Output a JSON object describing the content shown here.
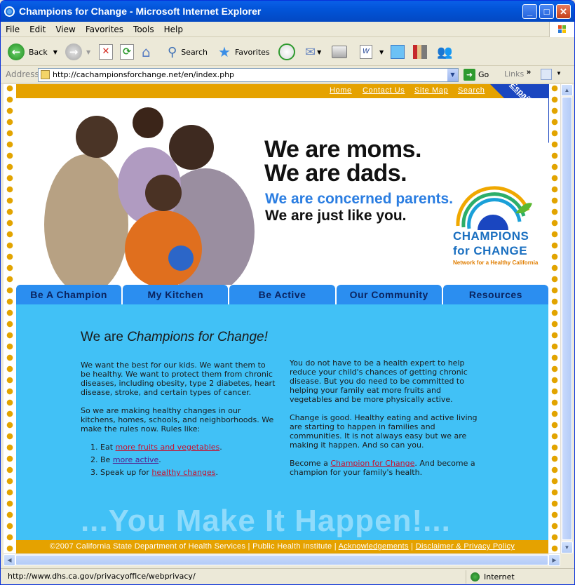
{
  "window": {
    "title": "Champions for Change - Microsoft Internet Explorer"
  },
  "menu": [
    "File",
    "Edit",
    "View",
    "Favorites",
    "Tools",
    "Help"
  ],
  "toolbar": {
    "back": "Back",
    "search": "Search",
    "favorites": "Favorites"
  },
  "address": {
    "label": "Address",
    "url": "http://cachampionsforchange.net/en/index.php",
    "go": "Go",
    "links": "Links"
  },
  "status": {
    "text": "http://www.dhs.ca.gov/privacyoffice/webprivacy/",
    "zone": "Internet"
  },
  "site": {
    "topnav": [
      "Home",
      "Contact Us",
      "Site Map",
      "Search"
    ],
    "espanol": "Español",
    "hero": {
      "line1": "We are moms.",
      "line2": "We are dads.",
      "line3": "We are concerned parents.",
      "line4": "We are just like you."
    },
    "logo": {
      "line1": "CHAMPIONS",
      "line2": "for CHANGE",
      "tagline": "Network for a Healthy California"
    },
    "mainnav": [
      "Be A Champion",
      "My Kitchen",
      "Be Active",
      "Our Community",
      "Resources"
    ],
    "headline_prefix": "We are ",
    "headline_em": "Champions for Change!",
    "left_p1": "We want the best for our kids. We want them to be healthy. We want to protect them from chronic diseases, including obesity, type 2 diabetes, heart disease, stroke, and certain types of cancer.",
    "left_p2": "So we are making healthy changes in our kitchens, homes, schools, and neighborhoods. We make the rules now. Rules like:",
    "rules": [
      {
        "pre": "Eat ",
        "link": "more fruits and vegetables",
        "post": "."
      },
      {
        "pre": "Be ",
        "link": "more active",
        "post": "."
      },
      {
        "pre": "Speak up for ",
        "link": "healthy changes",
        "post": "."
      }
    ],
    "right_p1": "You do not have to be a health expert to help reduce your child's chances of getting chronic disease. But you do need to be committed to helping your family eat more fruits and vegetables and be more physically active.",
    "right_p2": "Change is good. Healthy eating and active living are starting to happen in families and communities. It is not always easy but we are making it happen. And so can you.",
    "right_p3_pre": "Become a ",
    "right_p3_link": "Champion for Change",
    "right_p3_post": ". And become a champion for your family's health.",
    "slogan": "...You Make It Happen!...",
    "footer": {
      "copyright": "©2007 California State Department of Health Services | Public Health Institute | ",
      "ack": "Acknowledgements",
      "sep": " | ",
      "disclaimer": "Disclaimer & Privacy Policy"
    }
  }
}
